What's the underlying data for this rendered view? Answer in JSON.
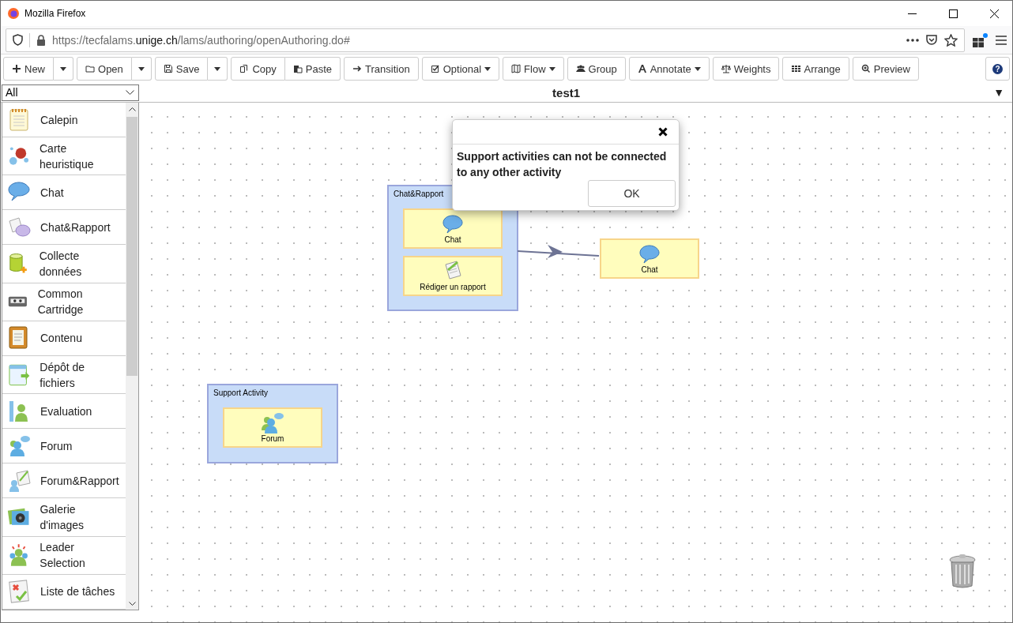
{
  "window": {
    "title": "Mozilla Firefox"
  },
  "address_bar": {
    "url_start": "https://tecfalams.",
    "url_host": "unige.ch",
    "url_end": "/lams/authoring/openAuthoring.do#"
  },
  "toolbar": [
    {
      "label": "New",
      "kind": "split"
    },
    {
      "label": "Open",
      "kind": "split"
    },
    {
      "label": "Save",
      "kind": "split"
    },
    {
      "label": "Copy",
      "kind": "joined"
    },
    {
      "label": "Paste",
      "kind": "plain"
    },
    {
      "label": "Transition",
      "kind": "plain"
    },
    {
      "label": "Optional",
      "kind": "dropdown"
    },
    {
      "label": "Flow",
      "kind": "dropdown"
    },
    {
      "label": "Group",
      "kind": "plain"
    },
    {
      "label": "Annotate",
      "kind": "dropdown"
    },
    {
      "label": "Weights",
      "kind": "plain"
    },
    {
      "label": "Arrange",
      "kind": "plain"
    },
    {
      "label": "Preview",
      "kind": "plain"
    }
  ],
  "help_button": {
    "label": "?"
  },
  "filter": {
    "value": "All"
  },
  "design": {
    "title": "test1",
    "menu_glyph": "▼"
  },
  "sidebar": {
    "items": [
      "Calepin",
      "Carte heuristique",
      "Chat",
      "Chat&Rapport",
      "Collecte données",
      "Common Cartridge",
      "Contenu",
      "Dépôt de fichiers",
      "Evaluation",
      "Forum",
      "Forum&Rapport",
      "Galerie d'images",
      "Leader Selection",
      "Liste de tâches"
    ]
  },
  "canvas": {
    "groups": [
      {
        "title": "Chat&Rapport",
        "activities": [
          {
            "label": "Chat",
            "kind": "chat"
          },
          {
            "label": "Rédiger un rapport",
            "kind": "report"
          }
        ]
      },
      {
        "title": "Support Activity",
        "activities": [
          {
            "label": "Forum",
            "kind": "forum"
          }
        ]
      }
    ],
    "activities": [
      {
        "label": "Chat",
        "kind": "chat"
      }
    ]
  },
  "dialog": {
    "message": "Support activities can not be connected to any other activity",
    "button": "OK"
  }
}
